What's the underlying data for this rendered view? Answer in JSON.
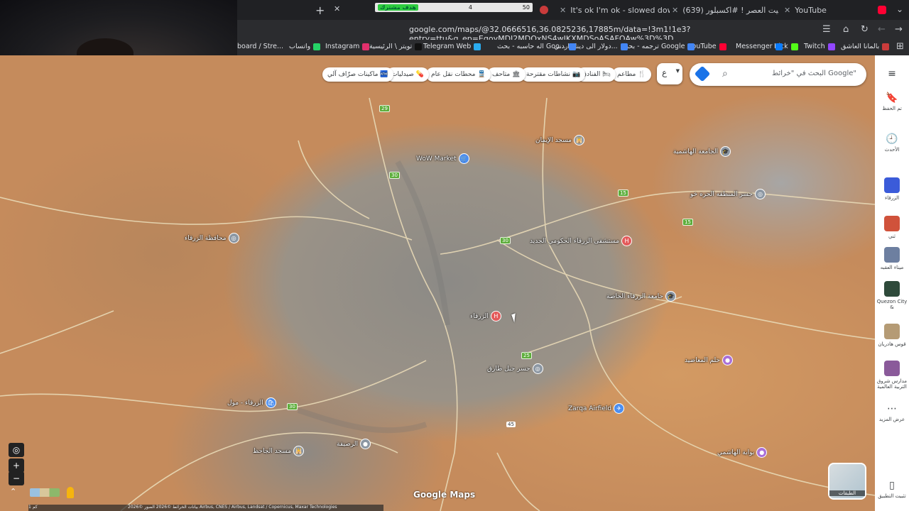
{
  "browser": {
    "tabs": [
      {
        "label": "",
        "color": "#c93b3b"
      },
      {
        "label": "It's ok I'm ok - slowed dow",
        "color": "#1ed760"
      },
      {
        "label": "(639) ما صليت العصر ! #اكسبلور",
        "color": "#ff0033"
      },
      {
        "label": "YouTube",
        "color": "#ff0033"
      }
    ],
    "overlay": {
      "badge": "هدف مشترك",
      "current": "4",
      "goal": "50"
    },
    "url": "google.com/maps/@32.0666516,36.0825236,17885m/data=!3m1!1e3?entry=ttu&g_ep=EgoyMDI2MDQxNS4wIKXMDSoASAFQAw%3D%3D",
    "bookmarks": [
      {
        "label": "بالمانا العاشق",
        "color": "#c93b3b"
      },
      {
        "label": "Twitch",
        "color": "#9146ff"
      },
      {
        "label": "Kick",
        "color": "#53fc18"
      },
      {
        "label": "Messenger",
        "color": "#0a7cff"
      },
      {
        "label": "YouTube",
        "color": "#ff0033"
      },
      {
        "label": "ترجمه - بحث Google",
        "color": "#4285f4"
      },
      {
        "label": "دولار الى دينار اردني...",
        "color": "#4285f4"
      },
      {
        "label": "اله حاسبه - بحث Goo...",
        "color": "#4285f4"
      },
      {
        "label": "Telegram Web",
        "color": "#2aabee"
      },
      {
        "label": "تويتر \\ الرئيسية",
        "color": "#111111"
      },
      {
        "label": "Instagram",
        "color": "#e1306c"
      },
      {
        "label": "واتساب",
        "color": "#25d366"
      },
      {
        "label": "board / Stre...",
        "color": "#3c3c3c"
      }
    ]
  },
  "maps": {
    "search_placeholder": "البحث في \"خرائط Google\"",
    "lang_label": "ع",
    "chips": [
      {
        "label": "مطاعم",
        "icon": "🍴"
      },
      {
        "label": "الفنادق",
        "icon": "🛏"
      },
      {
        "label": "نشاطات مقترحة",
        "icon": "📷"
      },
      {
        "label": "متاحف",
        "icon": "🏛"
      },
      {
        "label": "محطات نقل عام",
        "icon": "🚆"
      },
      {
        "label": "صيدليات",
        "icon": "💊"
      },
      {
        "label": "ماكينات صرّاف آلي",
        "icon": "🏧"
      }
    ],
    "places": [
      {
        "label": "WoW Market",
        "color": "#4b8ef0",
        "icon": "🛒"
      },
      {
        "label": "الزرقاء",
        "color": "#e35a5a",
        "icon": "H"
      },
      {
        "label": "مستشفى الزرقاء الحكومي الجديد",
        "color": "#e35a5a",
        "icon": "H"
      },
      {
        "label": "مسجد الإيمان",
        "color": "#8c97a3",
        "icon": "🕌"
      },
      {
        "label": "الجامعة الهاشمية",
        "color": "#8c97a3",
        "icon": "🎓"
      },
      {
        "label": "جسر المنطقه الحره خو",
        "color": "#8c97a3",
        "icon": "◎"
      },
      {
        "label": "جامعة الزرقاء الخاصة",
        "color": "#8c97a3",
        "icon": "🎓"
      },
      {
        "label": "Zarqa Airfield",
        "color": "#4b8ef0",
        "icon": "✈"
      },
      {
        "label": "حلم المعاضيد",
        "color": "#a970d8",
        "icon": "●"
      },
      {
        "label": "محافظة الزرقاء",
        "color": "#8c97a3",
        "icon": "◎"
      },
      {
        "label": "الرصيفة",
        "color": "#8c97a3",
        "icon": "●"
      },
      {
        "label": "الزرقاء - مول",
        "color": "#4b8ef0",
        "icon": "🛍"
      },
      {
        "label": "مسجد الجاحظ",
        "color": "#8c97a3",
        "icon": "🕌"
      },
      {
        "label": "جسر جبل طارق",
        "color": "#8c97a3",
        "icon": "◎"
      },
      {
        "label": "بوابة الهاشمي",
        "color": "#a970d8",
        "icon": "●"
      }
    ],
    "shields": [
      "29",
      "30",
      "15",
      "30",
      "15",
      "45",
      "30",
      "25"
    ],
    "rail": [
      {
        "label": "تم الحفظ",
        "icon": "🔖"
      },
      {
        "label": "الأحدث",
        "icon": "🕘"
      },
      {
        "label": "الزرقاء",
        "thumb": "#3b5bd9"
      },
      {
        "label": "ثني",
        "thumb": "#d0523b"
      },
      {
        "label": "ميناء العقبه",
        "thumb": "#6d7fa0"
      },
      {
        "label": "Quezon City &",
        "thumb": "#2e4a3a"
      },
      {
        "label": "قوس هادريان",
        "thumb": "#b59b75"
      },
      {
        "label": "مدارس شروق التربية العالمية",
        "thumb": "#8a5a9a"
      },
      {
        "label": "عرض المزيد",
        "icon": "⋯"
      }
    ],
    "rail_bottom": "تثبيت التطبيق",
    "layers_label": "الطبقات",
    "logo": "Google Maps",
    "attribution": "بيانات الخرائط ©2026 الصور ©2026 Airbus, CNES / Airbus, Landsat / Copernicus, Maxar Technologies",
    "scale": "1 كم"
  }
}
